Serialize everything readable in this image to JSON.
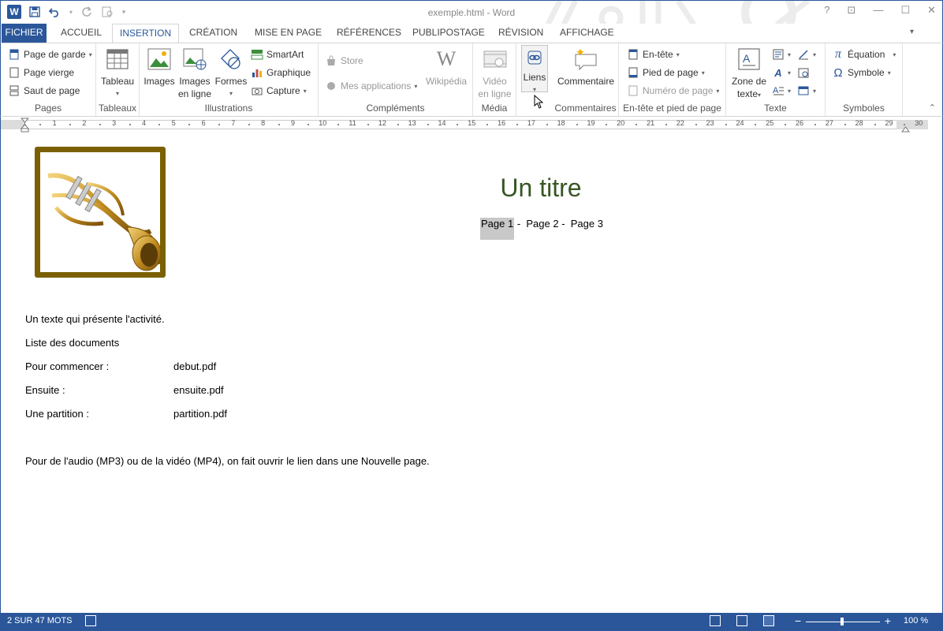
{
  "window": {
    "title": "exemple.html - Word",
    "help": "?",
    "app_letter": "W"
  },
  "tabs": [
    "FICHIER",
    "ACCUEIL",
    "INSERTION",
    "CRÉATION",
    "MISE EN PAGE",
    "RÉFÉRENCES",
    "PUBLIPOSTAGE",
    "RÉVISION",
    "AFFICHAGE"
  ],
  "ribbon": {
    "pages": {
      "label": "Pages",
      "items": [
        "Page de garde",
        "Page vierge",
        "Saut de page"
      ]
    },
    "tableaux": {
      "label": "Tableaux",
      "tableau": "Tableau"
    },
    "illustrations": {
      "label": "Illustrations",
      "images": "Images",
      "images_ligne_1": "Images",
      "images_ligne_2": "en ligne",
      "formes": "Formes",
      "smartart": "SmartArt",
      "graphique": "Graphique",
      "capture": "Capture"
    },
    "complements": {
      "label": "Compléments",
      "store": "Store",
      "mes_apps": "Mes applications",
      "wikipedia": "Wikipédia"
    },
    "media": {
      "label": "Média",
      "video_1": "Vidéo",
      "video_2": "en ligne"
    },
    "liens": {
      "label": "Liens"
    },
    "commentaires": {
      "label": "Commentaires",
      "commentaire": "Commentaire"
    },
    "entete": {
      "label": "En-tête et pied de page",
      "entete": "En-tête",
      "pied": "Pied de page",
      "numero": "Numéro de page"
    },
    "texte": {
      "label": "Texte",
      "zone_1": "Zone de",
      "zone_2": "texte"
    },
    "symboles": {
      "label": "Symboles",
      "equation": "Équation",
      "symbole": "Symbole"
    }
  },
  "ruler": {
    "numbers": [
      "2",
      "1",
      "1",
      "2",
      "3",
      "4",
      "5",
      "6",
      "7",
      "8",
      "9",
      "10",
      "11",
      "12",
      "13",
      "14",
      "15",
      "16",
      "17",
      "18",
      "19",
      "20",
      "21",
      "22",
      "23",
      "24",
      "25",
      "26",
      "27",
      "28",
      "29",
      "30"
    ]
  },
  "document": {
    "title": "Un titre",
    "page_links": {
      "p1": "Page 1",
      "sep1": " -  ",
      "p2": "Page 2",
      "sep2": " -  ",
      "p3": "Page 3"
    },
    "intro": "Un texte qui présente l'activité.",
    "list_heading": "Liste des documents",
    "rows": [
      {
        "label": "Pour commencer :",
        "file": "debut.pdf"
      },
      {
        "label": "Ensuite :",
        "file": "ensuite.pdf"
      },
      {
        "label": "Une partition :",
        "file": "partition.pdf"
      }
    ],
    "footer_text": "Pour de l'audio (MP3) ou de la vidéo (MP4), on fait ouvrir le lien dans une Nouvelle page."
  },
  "statusbar": {
    "words": "2 SUR 47 MOTS",
    "zoom": "100 %"
  },
  "colors": {
    "accent": "#2b579a",
    "title_green": "#375623",
    "frame": "#7a6000",
    "annotation": "#d01818"
  }
}
